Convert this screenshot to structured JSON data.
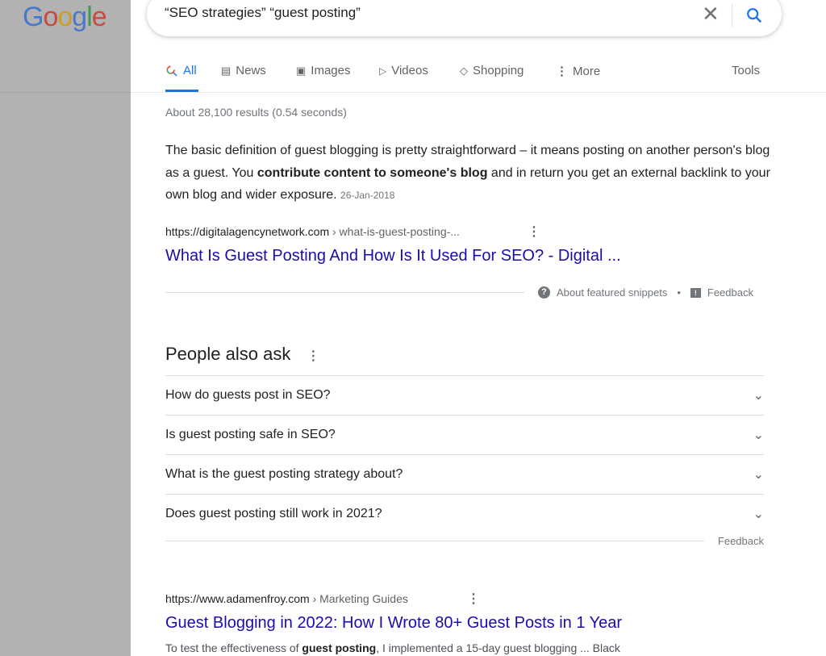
{
  "logo": "Google",
  "search": {
    "query": "“SEO strategies” “guest posting”"
  },
  "tabs": [
    {
      "label": "All",
      "icon": "search-icon"
    },
    {
      "label": "News",
      "icon": "news-icon"
    },
    {
      "label": "Images",
      "icon": "image-icon"
    },
    {
      "label": "Videos",
      "icon": "video-icon"
    },
    {
      "label": "Shopping",
      "icon": "tag-icon"
    },
    {
      "label": "More",
      "icon": "more-vert-icon"
    }
  ],
  "tools": "Tools",
  "stats": "About 28,100 results (0.54 seconds)",
  "snippet": {
    "pre": "The basic definition of guest blogging is pretty straightforward – it means posting on another person's blog as a guest. You ",
    "bold": "contribute content to someone's blog",
    "post": " and in return you get an external backlink to your own blog and wider exposure.",
    "date": "26-Jan-2018",
    "url": "https://digitalagencynetwork.com",
    "path": " › what-is-guest-posting-...",
    "title": "What Is Guest Posting And How Is It Used For SEO? - Digital ...",
    "about": "About featured snippets",
    "feedback": "Feedback"
  },
  "paa": {
    "heading": "People also ask",
    "questions": [
      "How do guests post in SEO?",
      "Is guest posting safe in SEO?",
      "What is the guest posting strategy about?",
      "Does guest posting still work in 2021?"
    ],
    "feedback": "Feedback"
  },
  "result2": {
    "url": "https://www.adamenfroy.com",
    "path": " › Marketing Guides",
    "title": "Guest Blogging in 2022: How I Wrote 80+ Guest Posts in 1 Year",
    "desc_pre": "To test the effectiveness of ",
    "desc_bold": "guest posting",
    "desc_post": ", I implemented a 15-day guest blogging ... Black"
  }
}
